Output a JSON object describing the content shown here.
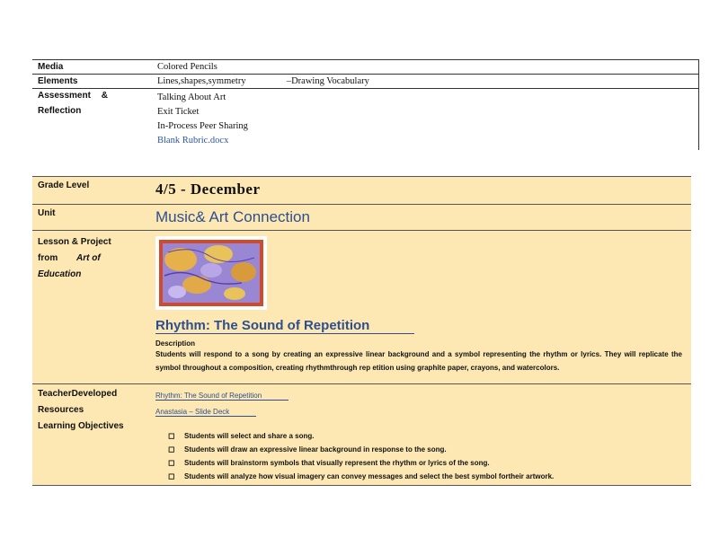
{
  "top_table": {
    "rows": [
      {
        "label": "Media",
        "values": [
          "Colored Pencils"
        ]
      },
      {
        "label": "Elements",
        "values": [
          "Lines,shapes,symmetry",
          "–Drawing Vocabulary"
        ]
      },
      {
        "label_a": "Assessment",
        "label_b": "&",
        "label_c": "Reflection",
        "values": [
          "Talking About Art",
          "Exit Ticket",
          "In-Process Peer Sharing"
        ],
        "link": "Blank Rubric.docx"
      }
    ]
  },
  "lesson_table": {
    "grade_label": "Grade Level",
    "grade_value": "4/5 - December",
    "unit_label": "Unit",
    "unit_value": "Music& Art Connection",
    "lesson_label_a": "Lesson & Project",
    "lesson_label_b": "from",
    "lesson_label_c": "Art of",
    "lesson_label_d": "Education",
    "lesson_title": "Rhythm: The Sound of Repetition",
    "description_heading": "Description",
    "description": "Students will respond to a song by creating an expressive linear background and a symbol representing the rhythm or lyrics. They will replicate the symbol throughout a composition, creating rhythmthrough rep etition using graphite paper, crayons, and watercolors.",
    "resources_label_a": "TeacherDeveloped",
    "resources_label_b": "Resources",
    "objectives_label": "Learning Objectives",
    "resource_links": [
      "Rhythm: The Sound of Repetition",
      "Anastasia – Slide Deck"
    ],
    "objectives": [
      "Students will select and share a song.",
      "Students will draw an expressive linear background in response to the song.",
      "Students will brainstorm symbols that visually represent the rhythm or lyrics of the song.",
      "Students will analyze how visual imagery can convey messages and select the best symbol fortheir artwork."
    ],
    "bullet_glyph": "◻"
  }
}
